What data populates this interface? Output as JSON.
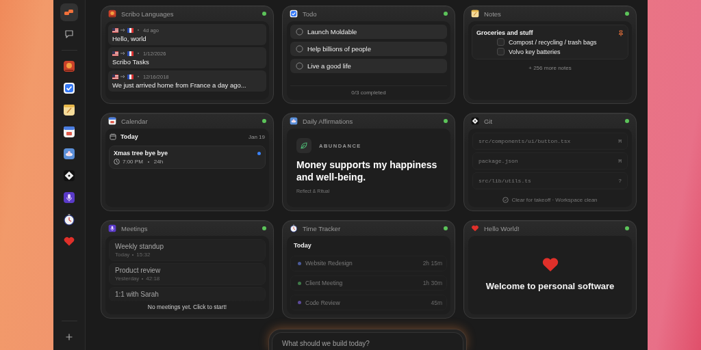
{
  "sidebar": {
    "items": [
      {
        "kind": "logo",
        "selected": true
      },
      {
        "kind": "chat",
        "selected": false
      },
      {
        "kind": "book",
        "selected": false
      },
      {
        "kind": "todo",
        "selected": false
      },
      {
        "kind": "notes",
        "selected": false
      },
      {
        "kind": "calendar",
        "selected": false
      },
      {
        "kind": "lotus",
        "selected": false
      },
      {
        "kind": "git",
        "selected": false
      },
      {
        "kind": "mic",
        "selected": false
      },
      {
        "kind": "timer",
        "selected": false
      },
      {
        "kind": "heart",
        "selected": false
      }
    ]
  },
  "widgets": [
    {
      "kind": "languages",
      "title": "Scribo Languages",
      "online": true,
      "entries": [
        {
          "time": "4d ago",
          "text": "Hello, world"
        },
        {
          "time": "1/12/2026",
          "text": "Scribo Tasks"
        },
        {
          "time": "12/16/2018",
          "text": "We just arrived home from France a day ago..."
        }
      ]
    },
    {
      "kind": "todo",
      "title": "Todo",
      "online": true,
      "items": [
        {
          "label": "Launch Moldable",
          "checked": false
        },
        {
          "label": "Help billions of people",
          "checked": false
        },
        {
          "label": "Live a good life",
          "checked": false
        }
      ],
      "footer": "0/3 completed"
    },
    {
      "kind": "notes",
      "title": "Notes",
      "online": true,
      "note": {
        "title": "Groceries and stuff",
        "pinned": true,
        "items": [
          {
            "label": "Compost / recycling / trash bags",
            "checked": false
          },
          {
            "label": "Volvo key batteries",
            "checked": false
          }
        ]
      },
      "more": "+ 256 more notes"
    },
    {
      "kind": "calendar",
      "title": "Calendar",
      "online": true,
      "day": "Today",
      "date": "Jan 19",
      "events": [
        {
          "title": "Xmas tree bye bye",
          "time": "7:00 PM",
          "duration": "24h",
          "color": "#3b82f6"
        }
      ]
    },
    {
      "kind": "affirmation",
      "title": "Daily Affirmations",
      "online": true,
      "category": "ABUNDANCE",
      "quote": "Money supports my happiness and well-being.",
      "source": "Reflect & Ritual"
    },
    {
      "kind": "git",
      "title": "Git",
      "online": true,
      "files": [
        {
          "path": "src/components/ui/button.tsx",
          "status": "M"
        },
        {
          "path": "package.json",
          "status": "M"
        },
        {
          "path": "src/lib/utils.ts",
          "status": "?"
        }
      ],
      "footer": "Clear for takeoff · Workspace clean"
    },
    {
      "kind": "meetings",
      "title": "Meetings",
      "online": true,
      "items": [
        {
          "title": "Weekly standup",
          "day": "Today",
          "duration": "15:32"
        },
        {
          "title": "Product review",
          "day": "Yesterday",
          "duration": "42:18"
        },
        {
          "title": "1:1 with Sarah"
        }
      ],
      "empty": "No meetings yet. Click to start!"
    },
    {
      "kind": "timer",
      "title": "Time Tracker",
      "online": true,
      "heading": "Today",
      "entries": [
        {
          "label": "Website Redesign",
          "duration": "2h 15m",
          "color": "#4a5a9a"
        },
        {
          "label": "Client Meeting",
          "duration": "1h 30m",
          "color": "#3f7a48"
        },
        {
          "label": "Code Review",
          "duration": "45m",
          "color": "#5c4a9a"
        }
      ]
    },
    {
      "kind": "hello",
      "title": "Hello World!",
      "online": true,
      "message": "Welcome to personal software"
    }
  ],
  "prompt": {
    "placeholder": "What should we build today?"
  }
}
